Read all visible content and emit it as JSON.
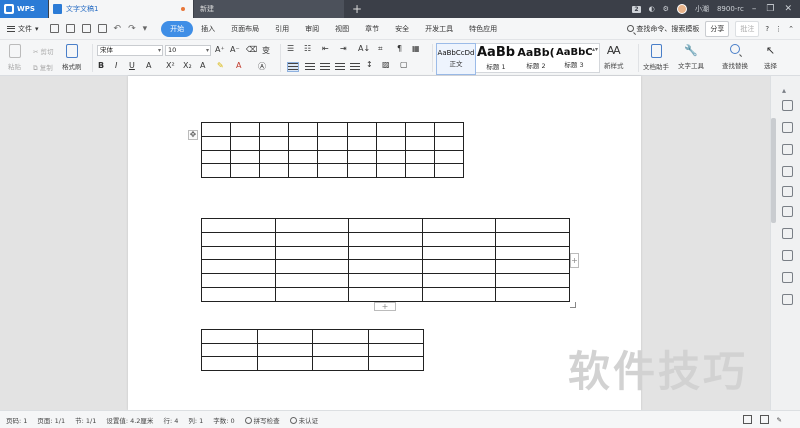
{
  "titlebar": {
    "app_name": "WPS",
    "doc_tab": "文字文稿1",
    "new_tab": "新建",
    "add_tab": "+",
    "badge": "2",
    "user_name": "小潮",
    "user_id": "8900-rc"
  },
  "menubar": {
    "file": "文件",
    "tabs": [
      "开始",
      "插入",
      "页面布局",
      "引用",
      "审阅",
      "视图",
      "章节",
      "安全",
      "开发工具",
      "特色应用"
    ],
    "active_tab": "开始",
    "search_cmd": "查找命令、搜索模板",
    "share": "分享",
    "comment": "批注",
    "help": "?"
  },
  "ribbon": {
    "paste": "粘贴",
    "cut": "剪切",
    "copy": "复制",
    "format_painter": "格式刷",
    "font_name": "宋体",
    "font_size": "10",
    "styles": [
      {
        "sample": "AaBbCcDd",
        "label": "正文"
      },
      {
        "sample": "AaBb",
        "label": "标题 1"
      },
      {
        "sample": "AaBb(",
        "label": "标题 2"
      },
      {
        "sample": "AaBbC",
        "label": "标题 3"
      }
    ],
    "new_style": "新样式",
    "doc_helper": "文档助手",
    "text_tools": "文字工具",
    "find_replace": "查找替换",
    "select": "选择"
  },
  "document": {
    "tables": [
      {
        "rows": 4,
        "cols": 9
      },
      {
        "rows": 6,
        "cols": 5
      },
      {
        "rows": 3,
        "cols": 4
      }
    ],
    "add_symbol": "+"
  },
  "watermark": "软件技巧",
  "statusbar": {
    "page_num": "页码: 1",
    "page": "页面: 1/1",
    "section": "节: 1/1",
    "setting": "设置值: 4.2厘米",
    "row": "行: 4",
    "col": "列: 1",
    "word_count": "字数: 0",
    "spell_check": "拼写检查",
    "auth": "未认证"
  }
}
